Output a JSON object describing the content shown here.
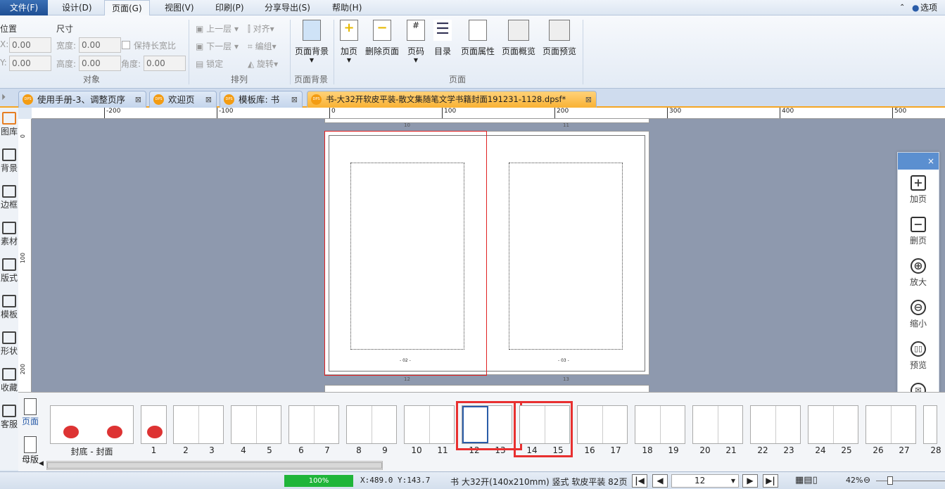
{
  "menu": {
    "items": [
      "文件(F)",
      "设计(D)",
      "页面(G)",
      "视图(V)",
      "印刷(P)",
      "分享导出(S)",
      "帮助(H)"
    ],
    "options": "选项"
  },
  "ribbon": {
    "object": {
      "position": "位置",
      "size": "尺寸",
      "x_label": "X:",
      "x": "0.00",
      "y_label": "Y:",
      "y": "0.00",
      "width_label": "宽度:",
      "width": "0.00",
      "height_label": "高度:",
      "height": "0.00",
      "keep_ratio": "保持长宽比",
      "angle_label": "角度:",
      "angle": "0.00",
      "group": "对象"
    },
    "arrange": {
      "up": "上一层",
      "down": "下一层",
      "lock": "锁定",
      "align": "对齐",
      "group_edit": "编组",
      "rotate": "旋转",
      "group": "排列"
    },
    "background": {
      "button": "页面背景",
      "group": "页面背景"
    },
    "page": {
      "buttons": [
        "加页",
        "删除页面",
        "页码",
        "目录",
        "页面属性",
        "页面概览",
        "页面预览"
      ],
      "group": "页面"
    }
  },
  "tabs": [
    {
      "label": "使用手册-3、调整页序"
    },
    {
      "label": "欢迎页"
    },
    {
      "label": "模板库: 书"
    },
    {
      "label": "书-大32开软皮平装-散文集随笔文学书籍封面191231-1128.dpsf*"
    }
  ],
  "ruler": {
    "marks": [
      "-200",
      "-100",
      "0",
      "100",
      "200",
      "300",
      "400",
      "500"
    ],
    "vmarks": [
      "0",
      "100",
      "200"
    ]
  },
  "sidebar": [
    "图库",
    "背景",
    "边框",
    "素材",
    "版式",
    "模板",
    "形状",
    "收藏",
    "客服"
  ],
  "canvas": {
    "top_labels": [
      "10",
      "11"
    ],
    "page_numbers": [
      "- 02 -",
      "- 03 -"
    ],
    "bottom_labels": [
      "12",
      "13"
    ]
  },
  "right_panel": {
    "close": "×",
    "items": [
      "加页",
      "删页",
      "放大",
      "缩小",
      "预览",
      "分享"
    ]
  },
  "thumbnails": {
    "tabs": [
      "页面",
      "母版"
    ],
    "cover": "封底 - 封面",
    "single": "1",
    "pairs": [
      [
        "2",
        "3"
      ],
      [
        "4",
        "5"
      ],
      [
        "6",
        "7"
      ],
      [
        "8",
        "9"
      ],
      [
        "10",
        "11"
      ],
      [
        "12",
        "13"
      ],
      [
        "14",
        "15"
      ],
      [
        "16",
        "17"
      ],
      [
        "18",
        "19"
      ],
      [
        "20",
        "21"
      ],
      [
        "22",
        "23"
      ],
      [
        "24",
        "25"
      ],
      [
        "26",
        "27"
      ],
      [
        "28"
      ]
    ]
  },
  "status": {
    "progress": "100%",
    "progress_value": 100,
    "coords": "X:489.0  Y:143.7",
    "doc_info": "书 大32开(140x210mm) 竖式 软皮平装 82页",
    "page": "12",
    "zoom": "42%"
  }
}
